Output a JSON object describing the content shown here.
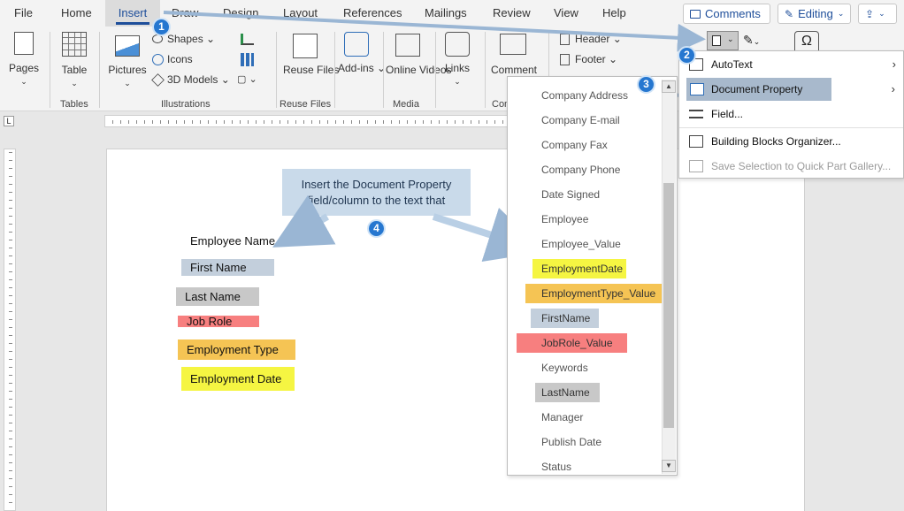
{
  "menu": {
    "tabs": [
      "File",
      "Home",
      "Insert",
      "Draw",
      "Design",
      "Layout",
      "References",
      "Mailings",
      "Review",
      "View",
      "Help"
    ],
    "active_tab": "Insert",
    "comments_label": "Comments",
    "editing_label": "Editing"
  },
  "ribbon": {
    "pages_label": "Pages",
    "table_label": "Table",
    "tables_group": "Tables",
    "pictures_label": "Pictures",
    "shapes_label": "Shapes",
    "icons_label": "Icons",
    "models_label": "3D Models",
    "illustrations_group": "Illustrations",
    "reuse_files_label": "Reuse Files",
    "reuse_files_group": "Reuse Files",
    "addins_label": "Add-ins",
    "online_videos_label": "Online Videos",
    "media_group": "Media",
    "links_label": "Links",
    "comment_label": "Comment",
    "comments_group_partial": "Con",
    "header_label": "Header",
    "footer_label": "Footer"
  },
  "quick_parts_menu": {
    "items": [
      {
        "label": "AutoText",
        "icon": "autotext-icon",
        "submenu": true,
        "enabled": true
      },
      {
        "label": "Document Property",
        "icon": "document-property-icon",
        "submenu": true,
        "enabled": true,
        "highlighted": true
      },
      {
        "label": "Field...",
        "icon": "field-icon",
        "submenu": false,
        "enabled": true
      },
      {
        "label": "Building Blocks Organizer...",
        "icon": "building-blocks-icon",
        "submenu": false,
        "enabled": true
      },
      {
        "label": "Save Selection to Quick Part Gallery...",
        "icon": "save-selection-icon",
        "submenu": false,
        "enabled": false
      }
    ]
  },
  "property_list": {
    "items": [
      {
        "label": "Company Address",
        "color": ""
      },
      {
        "label": "Company E-mail",
        "color": ""
      },
      {
        "label": "Company Fax",
        "color": ""
      },
      {
        "label": "Company Phone",
        "color": ""
      },
      {
        "label": "Date Signed",
        "color": ""
      },
      {
        "label": "Employee",
        "color": ""
      },
      {
        "label": "Employee_Value",
        "color": ""
      },
      {
        "label": "EmploymentDate",
        "color": "#f5f542"
      },
      {
        "label": "EmploymentType_Value",
        "color": "#f5c454"
      },
      {
        "label": "FirstName",
        "color": "#c3cfdc"
      },
      {
        "label": "JobRole_Value",
        "color": "#f77f7f"
      },
      {
        "label": "Keywords",
        "color": ""
      },
      {
        "label": "LastName",
        "color": "#c8c8c8"
      },
      {
        "label": "Manager",
        "color": ""
      },
      {
        "label": "Publish Date",
        "color": ""
      },
      {
        "label": "Status",
        "color": ""
      }
    ]
  },
  "document": {
    "heading": "Employee Name",
    "fields": [
      {
        "label": "First Name",
        "color": "#c3cfdc"
      },
      {
        "label": "Last Name",
        "color": "#c8c8c8"
      },
      {
        "label": "Job Role",
        "color": "#f77f7f"
      },
      {
        "label": "Employment Type",
        "color": "#f5c454"
      },
      {
        "label": "Employment Date",
        "color": "#f5f542"
      }
    ]
  },
  "callout": {
    "line1": "Insert the Document Property",
    "line2": "field/column to the text that"
  },
  "steps": [
    "1",
    "2",
    "3",
    "4"
  ],
  "colors": {
    "accent": "#1e4e9a",
    "step_badge": "#2677d0",
    "callout_bg": "#c9daea",
    "menu_highlight": "#a8b9cc"
  }
}
